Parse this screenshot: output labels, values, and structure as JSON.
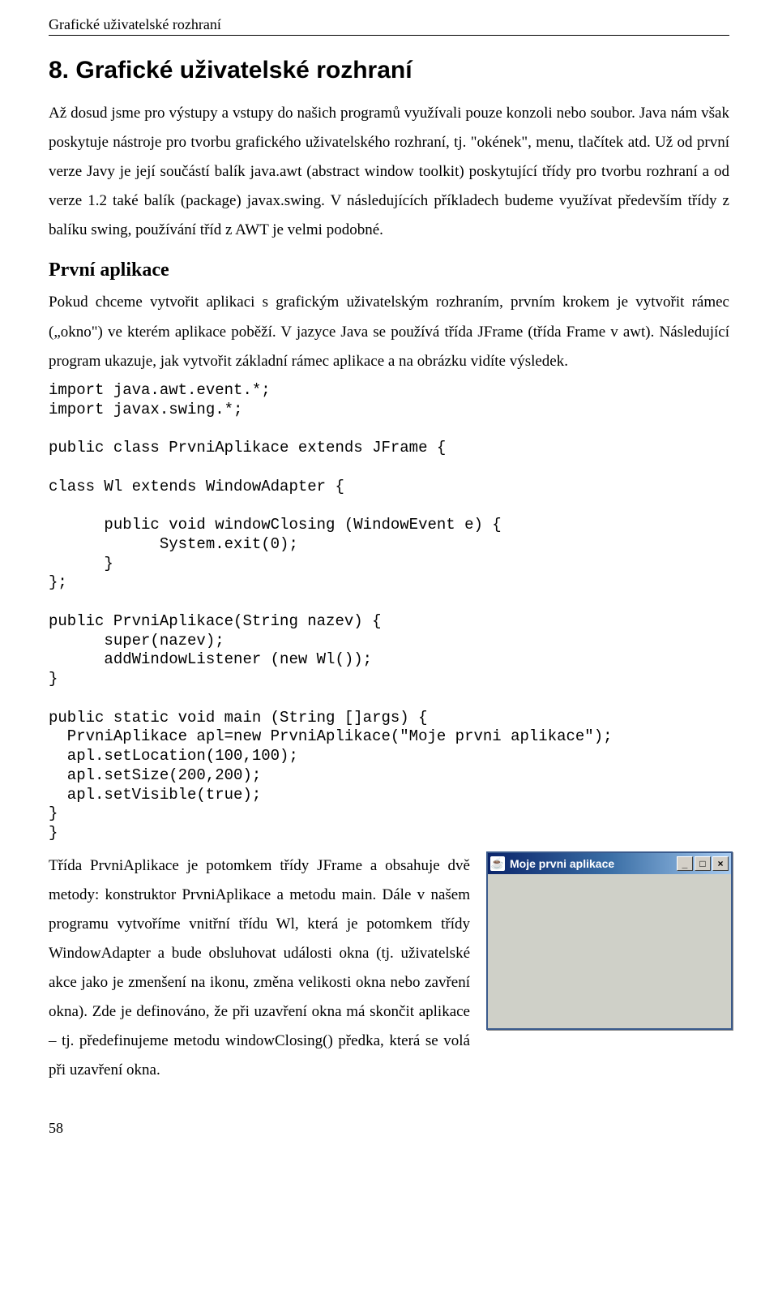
{
  "running_head": "Grafické uživatelské rozhraní",
  "title": "8. Grafické uživatelské rozhraní",
  "intro": "Až dosud jsme pro výstupy a vstupy do našich programů využívali pouze konzoli nebo soubor. Java nám však poskytuje nástroje pro tvorbu grafického uživatelského rozhraní, tj. \"okének\", menu, tlačítek atd. Už od první verze Javy je její součástí balík java.awt (abstract window toolkit) poskytující třídy pro tvorbu rozhraní a od verze 1.2 také balík (package) javax.swing. V následujících příkladech budeme využívat především třídy z balíku swing, používání tříd z AWT je velmi podobné.",
  "section_heading": "První aplikace",
  "section_body": "Pokud chceme vytvořit aplikaci s grafickým uživatelským rozhraním, prvním krokem je vytvořit rámec („okno\") ve kterém aplikace poběží. V jazyce Java se používá třída JFrame (třída Frame v awt). Následující program ukazuje, jak vytvořit základní rámec aplikace a na obrázku vidíte výsledek.",
  "code": "import java.awt.event.*;\nimport javax.swing.*;\n\npublic class PrvniAplikace extends JFrame {\n\nclass Wl extends WindowAdapter {\n\n      public void windowClosing (WindowEvent e) {\n            System.exit(0);\n      }\n};\n\npublic PrvniAplikace(String nazev) {\n      super(nazev);\n      addWindowListener (new Wl());\n}\n\npublic static void main (String []args) {\n  PrvniAplikace apl=new PrvniAplikace(\"Moje prvni aplikace\");\n  apl.setLocation(100,100);\n  apl.setSize(200,200);\n  apl.setVisible(true);\n}\n}",
  "after_code": "Třída PrvniAplikace je potomkem třídy JFrame a obsahuje dvě metody: konstruktor PrvniAplikace a metodu main. Dále v našem programu vytvoříme vnitřní třídu Wl, která je potomkem třídy WindowAdapter a bude obsluhovat události okna (tj. uživatelské akce jako je zmenšení na ikonu, změna velikosti okna nebo zavření okna). Zde je definováno, že při uzavření okna má skončit aplikace – tj. předefinujeme metodu windowClosing() předka, která se volá při uzavření okna.",
  "window": {
    "title": "Moje prvni aplikace",
    "icon_glyph": "☕",
    "minimize_glyph": "_",
    "maximize_glyph": "□",
    "close_glyph": "×"
  },
  "page_number": "58"
}
